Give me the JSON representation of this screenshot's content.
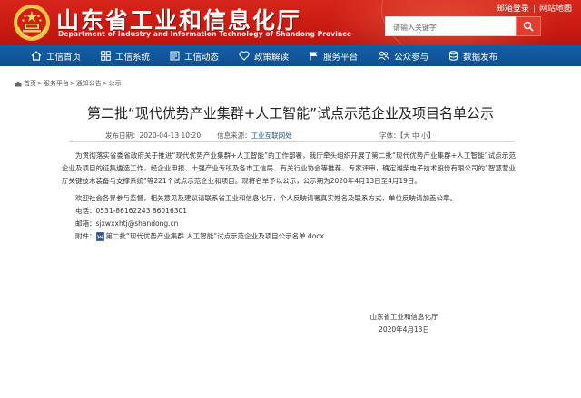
{
  "header": {
    "site_title": "山东省工业和信息化厅",
    "site_subtitle": "Department of Industry and Information Technology of Shandong Province",
    "top_links": [
      "邮箱登录",
      "网站地图"
    ],
    "search_placeholder": "请输入关键字"
  },
  "nav": {
    "items": [
      {
        "label": "工信首页",
        "icon": "home-icon"
      },
      {
        "label": "工信系统",
        "icon": "grid-icon"
      },
      {
        "label": "工信动态",
        "icon": "news-icon"
      },
      {
        "label": "政策解读",
        "icon": "heart-icon"
      },
      {
        "label": "服务平台",
        "icon": "flag-icon"
      },
      {
        "label": "公众参与",
        "icon": "people-icon"
      },
      {
        "label": "数据发布",
        "icon": "database-icon"
      }
    ]
  },
  "breadcrumb": [
    "首页",
    "服务平台",
    "通知公告",
    "公示"
  ],
  "article": {
    "title": "第二批“现代优势产业集群+人工智能”试点示范企业及项目名单公示",
    "publish_label": "发布日期：",
    "publish_date": "2020-04-13 10:20",
    "source_label": "信息来源：",
    "source": "工业互联网处",
    "font_label": "字体：",
    "font_open": "【",
    "font_sizes": [
      "大",
      "中",
      "小"
    ],
    "font_close": "】",
    "paragraph1": "为贯彻落实省委省政府关于推进“现代优势产业集群+人工智能”的工作部署，我厅牵头组织开展了第二批“现代优势产业集群+人工智能”试点示范企业及项目的征集遴选工作，经企业申报、十强产业专班及各市工信局、有关行业协会等推荐、专家评审，确定潍柴电子技术股份有限公司的“智慧营业厅关键技术装备与支撑系统”等221个试点示范企业和项目。现将名单予以公示，公示期为2020年4月13日至4月19日。",
    "paragraph2": "欢迎社会各界参与监督，相关意见及建议请联系省工业和信息化厅，个人反映请署真实姓名及联系方式，单位反映请加盖公章。",
    "phone": "电话：0531-86162243  86016301",
    "email": "邮箱：sjxwxxhtj@shandong.cn",
    "attachment_label": "附件：",
    "attachment_name": "第二批“现代优势产业集群 人工智能”试点示范企业及项目公示名单.docx",
    "sign_org": "山东省工业和信息化厅",
    "sign_date": "2020年4月13日"
  },
  "colors": {
    "header_red": "#c91a12",
    "nav_blue": "#0e4f92",
    "link_blue": "#1a4f9c"
  }
}
